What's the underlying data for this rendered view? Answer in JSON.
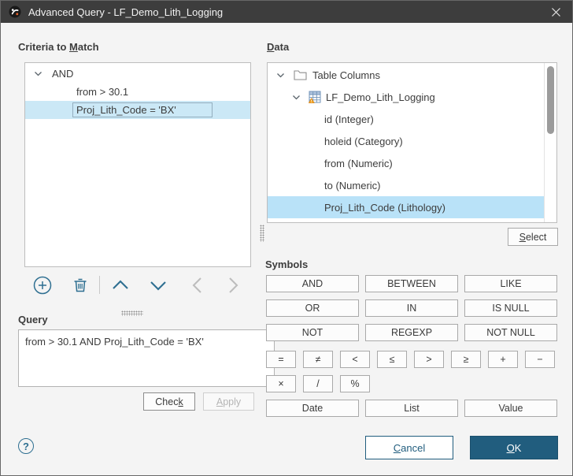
{
  "window": {
    "title": "Advanced Query - LF_Demo_Lith_Logging"
  },
  "colors": {
    "titlebar": "#3d3d3d",
    "accent_blue": "#2e6f91",
    "ok_button_bg": "#215d7e",
    "selection_blue": "#b9e2f8"
  },
  "icons": [
    "app-logo-icon",
    "close-icon",
    "chevron-down-icon",
    "folder-icon",
    "table-icon",
    "add-criteria-icon",
    "delete-criteria-icon",
    "move-up-icon",
    "move-down-icon",
    "move-left-icon",
    "move-right-icon",
    "help-icon"
  ],
  "criteria": {
    "label_pre": "Criteria to ",
    "label_mn": "M",
    "label_post": "atch",
    "tree": [
      {
        "text": "AND"
      },
      {
        "text": "from > 30.1"
      },
      {
        "text": "Proj_Lith_Code = 'BX'"
      }
    ]
  },
  "query": {
    "label": "Query",
    "text": "from > 30.1 AND Proj_Lith_Code = 'BX'",
    "check_pre": "Chec",
    "check_mn": "k",
    "apply_mn": "A",
    "apply_post": "pply"
  },
  "data_panel": {
    "label_mn": "D",
    "label_post": "ata",
    "tree": [
      {
        "text": "Table Columns"
      },
      {
        "text": "LF_Demo_Lith_Logging"
      },
      {
        "text": "id (Integer)"
      },
      {
        "text": "holeid (Category)"
      },
      {
        "text": "from (Numeric)"
      },
      {
        "text": "to (Numeric)"
      },
      {
        "text": "Proj_Lith_Code (Lithology)"
      }
    ],
    "select_mn": "S",
    "select_post": "elect"
  },
  "symbols": {
    "label": "Symbols",
    "keywords": [
      [
        "AND",
        "BETWEEN",
        "LIKE"
      ],
      [
        "OR",
        "IN",
        "IS NULL"
      ],
      [
        "NOT",
        "REGEXP",
        "NOT NULL"
      ]
    ],
    "operators1": [
      "=",
      "≠",
      "<",
      "≤",
      ">",
      "≥",
      "+",
      "−"
    ],
    "operators2": [
      "×",
      "/",
      "%"
    ],
    "value_buttons": [
      "Date",
      "List",
      "Value"
    ]
  },
  "footer": {
    "help": "?",
    "cancel_mn": "C",
    "cancel_post": "ancel",
    "ok_mn": "O",
    "ok_post": "K"
  }
}
